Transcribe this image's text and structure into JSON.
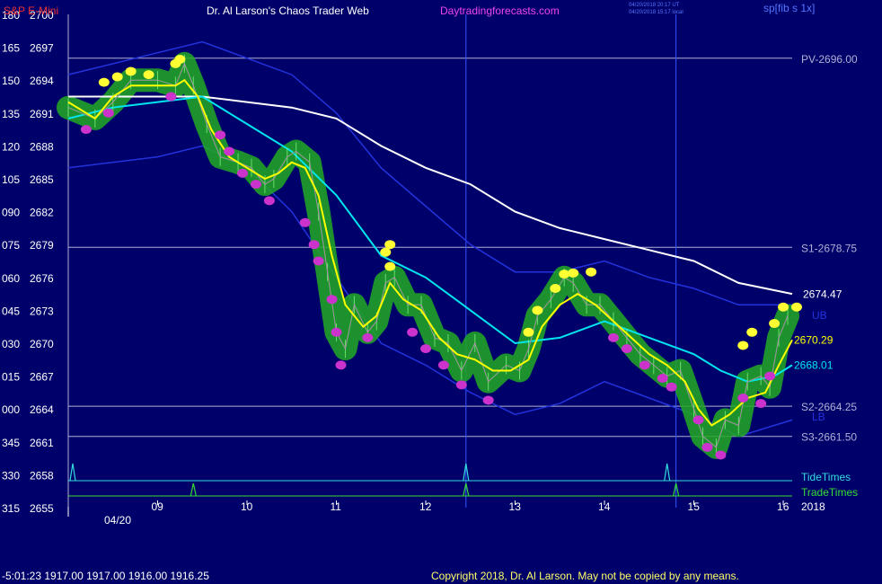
{
  "header": {
    "symbol": "S&P E-Mini",
    "title": "Dr. Al Larson's Chaos Trader Web",
    "site": "Daytradingforecasts.com",
    "stamp_ut": "04/20/2018 20:17 UT",
    "stamp_local": "04/20/2018 15:17 local",
    "small_right": "sp[fib s 1x]"
  },
  "footer": {
    "time_ohlc": "-5:01:23  1917.00 1917.00 1916.00 1916.25",
    "copyright": "Copyright 2018, Dr. Al Larson. May not be copied by any means."
  },
  "colors": {
    "background": "#00006a",
    "grid": "#b0b0d8",
    "price": "#00ee00",
    "fast_avg": "#ffff00",
    "mid_avg": "#00e5ee",
    "slow_avg": "#ffffff",
    "band": "#2233dd",
    "tide": "#33dddd",
    "trade": "#33dd33",
    "dot_high": "#ffff33",
    "dot_low": "#cc33cc"
  },
  "chart_data": {
    "type": "line",
    "title": "S&P E-Mini",
    "ylim": [
      2655,
      2700
    ],
    "y_ticks": [
      {
        "angle": "180",
        "price": "2700",
        "v": 2700
      },
      {
        "angle": "165",
        "price": "2697",
        "v": 2697
      },
      {
        "angle": "150",
        "price": "2694",
        "v": 2694
      },
      {
        "angle": "135",
        "price": "2691",
        "v": 2691
      },
      {
        "angle": "120",
        "price": "2688",
        "v": 2688
      },
      {
        "angle": "105",
        "price": "2685",
        "v": 2685
      },
      {
        "angle": "090",
        "price": "2682",
        "v": 2682
      },
      {
        "angle": "075",
        "price": "2679",
        "v": 2679
      },
      {
        "angle": "060",
        "price": "2676",
        "v": 2676
      },
      {
        "angle": "045",
        "price": "2673",
        "v": 2673
      },
      {
        "angle": "030",
        "price": "2670",
        "v": 2670
      },
      {
        "angle": "015",
        "price": "2667",
        "v": 2667
      },
      {
        "angle": "000",
        "price": "2664",
        "v": 2664
      },
      {
        "angle": "345",
        "price": "2661",
        "v": 2661
      },
      {
        "angle": "330",
        "price": "2658",
        "v": 2658
      },
      {
        "angle": "315",
        "price": "2655",
        "v": 2655
      }
    ],
    "xlim": [
      8.0,
      16.1
    ],
    "x_ticks": [
      {
        "label": "09",
        "v": 9
      },
      {
        "label": "10",
        "v": 10
      },
      {
        "label": "11",
        "v": 11
      },
      {
        "label": "12",
        "v": 12
      },
      {
        "label": "13",
        "v": 13
      },
      {
        "label": "14",
        "v": 14
      },
      {
        "label": "15",
        "v": 15
      },
      {
        "label": "16",
        "v": 16
      }
    ],
    "date_label": "04/20",
    "year_label": "2018",
    "levels": [
      {
        "name": "PV-2696.00",
        "v": 2696.0
      },
      {
        "name": "S1-2678.75",
        "v": 2678.75
      },
      {
        "name": "S2-2664.25",
        "v": 2664.25
      },
      {
        "name": "S3-2661.50",
        "v": 2661.5
      }
    ],
    "band_labels": {
      "upper": "UB",
      "lower": "LB"
    },
    "end_labels": [
      {
        "text": "2674.47",
        "v": 2674.47,
        "series": "slow"
      },
      {
        "text": "2670.29",
        "v": 2670.29,
        "series": "fast"
      },
      {
        "text": "2668.01",
        "v": 2668.01,
        "series": "mid"
      }
    ],
    "vlines": [
      12.45,
      14.8
    ],
    "tide_label": "TideTimes",
    "trade_label": "TradeTimes",
    "tide_times": [
      8.05,
      12.45,
      14.7
    ],
    "trade_times": [
      9.4,
      12.45,
      14.8
    ],
    "series": [
      {
        "key": "price",
        "points": [
          [
            8.0,
            2691.5
          ],
          [
            8.3,
            2690.5
          ],
          [
            8.5,
            2692.0
          ],
          [
            8.7,
            2694.0
          ],
          [
            9.0,
            2694.0
          ],
          [
            9.2,
            2693.5
          ],
          [
            9.3,
            2695.5
          ],
          [
            9.4,
            2693.5
          ],
          [
            9.55,
            2690.0
          ],
          [
            9.7,
            2687.0
          ],
          [
            9.9,
            2686.5
          ],
          [
            10.05,
            2686.0
          ],
          [
            10.2,
            2684.5
          ],
          [
            10.3,
            2685.0
          ],
          [
            10.45,
            2687.0
          ],
          [
            10.55,
            2687.5
          ],
          [
            10.7,
            2686.5
          ],
          [
            10.8,
            2682.0
          ],
          [
            10.9,
            2676.5
          ],
          [
            11.0,
            2671.0
          ],
          [
            11.1,
            2669.5
          ],
          [
            11.2,
            2673.5
          ],
          [
            11.35,
            2671.0
          ],
          [
            11.45,
            2672.0
          ],
          [
            11.55,
            2675.5
          ],
          [
            11.65,
            2676.0
          ],
          [
            11.8,
            2673.5
          ],
          [
            11.95,
            2673.5
          ],
          [
            12.1,
            2670.5
          ],
          [
            12.25,
            2670.0
          ],
          [
            12.4,
            2667.5
          ],
          [
            12.55,
            2670.0
          ],
          [
            12.7,
            2666.5
          ],
          [
            12.9,
            2668.0
          ],
          [
            13.05,
            2667.5
          ],
          [
            13.15,
            2669.5
          ],
          [
            13.25,
            2672.5
          ],
          [
            13.4,
            2674.0
          ],
          [
            13.55,
            2676.0
          ],
          [
            13.65,
            2675.5
          ],
          [
            13.8,
            2673.5
          ],
          [
            13.95,
            2673.5
          ],
          [
            14.1,
            2672.0
          ],
          [
            14.25,
            2670.5
          ],
          [
            14.4,
            2669.0
          ],
          [
            14.55,
            2668.0
          ],
          [
            14.7,
            2667.0
          ],
          [
            14.85,
            2667.5
          ],
          [
            15.0,
            2664.0
          ],
          [
            15.1,
            2661.5
          ],
          [
            15.25,
            2660.5
          ],
          [
            15.35,
            2663.0
          ],
          [
            15.5,
            2662.5
          ],
          [
            15.6,
            2666.5
          ],
          [
            15.75,
            2667.0
          ],
          [
            15.85,
            2666.0
          ],
          [
            15.95,
            2670.5
          ],
          [
            16.05,
            2672.5
          ]
        ]
      },
      {
        "key": "fast",
        "points": [
          [
            8.0,
            2692.0
          ],
          [
            8.3,
            2690.5
          ],
          [
            8.5,
            2692.5
          ],
          [
            8.7,
            2693.5
          ],
          [
            9.0,
            2693.5
          ],
          [
            9.2,
            2693.5
          ],
          [
            9.3,
            2694.0
          ],
          [
            9.45,
            2692.5
          ],
          [
            9.6,
            2689.5
          ],
          [
            9.8,
            2687.0
          ],
          [
            10.0,
            2686.0
          ],
          [
            10.2,
            2685.0
          ],
          [
            10.35,
            2685.5
          ],
          [
            10.5,
            2686.5
          ],
          [
            10.65,
            2686.0
          ],
          [
            10.8,
            2683.5
          ],
          [
            10.95,
            2678.0
          ],
          [
            11.1,
            2673.5
          ],
          [
            11.3,
            2671.5
          ],
          [
            11.45,
            2672.5
          ],
          [
            11.6,
            2675.5
          ],
          [
            11.75,
            2674.0
          ],
          [
            11.95,
            2673.0
          ],
          [
            12.15,
            2670.5
          ],
          [
            12.35,
            2669.0
          ],
          [
            12.55,
            2668.5
          ],
          [
            12.75,
            2667.5
          ],
          [
            12.95,
            2667.5
          ],
          [
            13.15,
            2668.5
          ],
          [
            13.3,
            2671.5
          ],
          [
            13.5,
            2673.5
          ],
          [
            13.7,
            2674.5
          ],
          [
            13.9,
            2673.5
          ],
          [
            14.1,
            2672.0
          ],
          [
            14.3,
            2670.5
          ],
          [
            14.5,
            2669.0
          ],
          [
            14.7,
            2668.0
          ],
          [
            14.9,
            2666.5
          ],
          [
            15.05,
            2664.0
          ],
          [
            15.2,
            2662.5
          ],
          [
            15.4,
            2663.5
          ],
          [
            15.6,
            2665.0
          ],
          [
            15.8,
            2665.5
          ],
          [
            15.95,
            2668.0
          ],
          [
            16.1,
            2670.3
          ]
        ]
      },
      {
        "key": "mid",
        "points": [
          [
            8.0,
            2690.5
          ],
          [
            8.5,
            2691.5
          ],
          [
            9.0,
            2692.0
          ],
          [
            9.5,
            2692.5
          ],
          [
            10.0,
            2690.0
          ],
          [
            10.5,
            2687.5
          ],
          [
            11.0,
            2683.5
          ],
          [
            11.5,
            2678.0
          ],
          [
            12.0,
            2676.0
          ],
          [
            12.5,
            2673.0
          ],
          [
            13.0,
            2670.0
          ],
          [
            13.5,
            2670.5
          ],
          [
            14.0,
            2672.0
          ],
          [
            14.5,
            2670.5
          ],
          [
            15.0,
            2669.0
          ],
          [
            15.3,
            2667.5
          ],
          [
            15.6,
            2666.5
          ],
          [
            15.9,
            2667.0
          ],
          [
            16.1,
            2668.0
          ]
        ]
      },
      {
        "key": "slow",
        "points": [
          [
            8.0,
            2692.5
          ],
          [
            8.5,
            2692.5
          ],
          [
            9.0,
            2692.5
          ],
          [
            9.5,
            2692.5
          ],
          [
            10.0,
            2692.0
          ],
          [
            10.5,
            2691.5
          ],
          [
            11.0,
            2690.5
          ],
          [
            11.5,
            2688.0
          ],
          [
            12.0,
            2686.0
          ],
          [
            12.5,
            2684.5
          ],
          [
            13.0,
            2682.0
          ],
          [
            13.5,
            2680.5
          ],
          [
            14.0,
            2679.5
          ],
          [
            14.5,
            2678.5
          ],
          [
            15.0,
            2677.5
          ],
          [
            15.5,
            2675.5
          ],
          [
            16.1,
            2674.5
          ]
        ]
      },
      {
        "key": "upper_band",
        "points": [
          [
            8.0,
            2694.5
          ],
          [
            9.0,
            2696.5
          ],
          [
            9.5,
            2697.5
          ],
          [
            10.0,
            2696.0
          ],
          [
            10.5,
            2694.5
          ],
          [
            11.0,
            2691.0
          ],
          [
            11.5,
            2686.0
          ],
          [
            12.0,
            2682.5
          ],
          [
            12.5,
            2679.0
          ],
          [
            13.0,
            2676.5
          ],
          [
            13.5,
            2676.5
          ],
          [
            14.0,
            2677.5
          ],
          [
            14.5,
            2676.0
          ],
          [
            15.0,
            2675.0
          ],
          [
            15.5,
            2673.5
          ],
          [
            16.1,
            2673.5
          ]
        ]
      },
      {
        "key": "lower_band",
        "points": [
          [
            8.0,
            2686.0
          ],
          [
            9.0,
            2687.0
          ],
          [
            9.5,
            2688.0
          ],
          [
            10.0,
            2686.0
          ],
          [
            10.5,
            2682.0
          ],
          [
            11.0,
            2676.0
          ],
          [
            11.5,
            2670.0
          ],
          [
            12.0,
            2668.0
          ],
          [
            12.5,
            2665.5
          ],
          [
            13.0,
            2663.5
          ],
          [
            13.5,
            2664.5
          ],
          [
            14.0,
            2666.5
          ],
          [
            14.5,
            2665.0
          ],
          [
            15.0,
            2663.5
          ],
          [
            15.5,
            2661.5
          ],
          [
            16.1,
            2663.0
          ]
        ]
      }
    ],
    "high_dots": [
      [
        8.4,
        2693.8
      ],
      [
        8.55,
        2694.3
      ],
      [
        8.7,
        2694.8
      ],
      [
        8.9,
        2694.5
      ],
      [
        9.2,
        2695.5
      ],
      [
        9.25,
        2695.9
      ],
      [
        11.6,
        2677.0
      ],
      [
        11.55,
        2678.3
      ],
      [
        11.6,
        2679.0
      ],
      [
        13.15,
        2671.0
      ],
      [
        13.25,
        2673.0
      ],
      [
        13.45,
        2675.0
      ],
      [
        13.55,
        2676.3
      ],
      [
        13.65,
        2676.4
      ],
      [
        13.85,
        2676.5
      ],
      [
        15.55,
        2669.8
      ],
      [
        15.65,
        2671.0
      ],
      [
        15.9,
        2671.8
      ],
      [
        16.0,
        2673.3
      ],
      [
        16.15,
        2673.3
      ]
    ],
    "low_dots": [
      [
        8.2,
        2689.5
      ],
      [
        8.45,
        2691.0
      ],
      [
        9.15,
        2692.5
      ],
      [
        9.7,
        2689.0
      ],
      [
        9.8,
        2687.5
      ],
      [
        9.95,
        2685.5
      ],
      [
        10.1,
        2684.5
      ],
      [
        10.25,
        2683.0
      ],
      [
        10.65,
        2681.0
      ],
      [
        10.75,
        2679.0
      ],
      [
        10.8,
        2677.5
      ],
      [
        10.95,
        2674.0
      ],
      [
        11.0,
        2671.0
      ],
      [
        11.05,
        2668.0
      ],
      [
        11.35,
        2670.5
      ],
      [
        11.85,
        2671.0
      ],
      [
        12.0,
        2669.5
      ],
      [
        12.2,
        2668.0
      ],
      [
        12.4,
        2666.2
      ],
      [
        12.7,
        2664.8
      ],
      [
        14.1,
        2670.5
      ],
      [
        14.25,
        2669.5
      ],
      [
        14.45,
        2668.0
      ],
      [
        14.65,
        2666.8
      ],
      [
        14.75,
        2666.0
      ],
      [
        15.05,
        2663.0
      ],
      [
        15.15,
        2660.5
      ],
      [
        15.3,
        2659.8
      ],
      [
        15.55,
        2665.0
      ],
      [
        15.75,
        2664.5
      ],
      [
        15.85,
        2667.0
      ]
    ]
  }
}
